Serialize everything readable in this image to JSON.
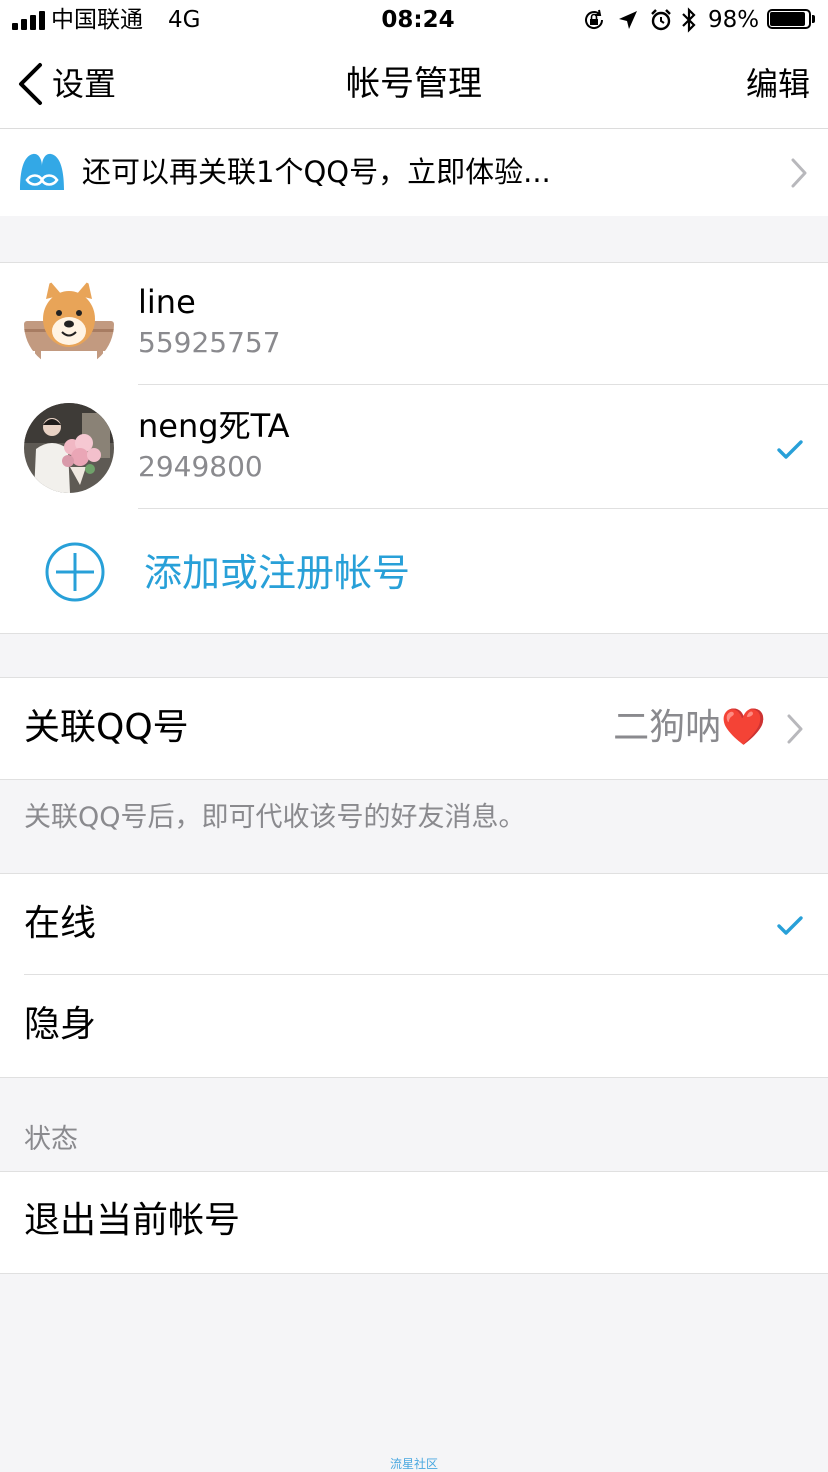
{
  "status_bar": {
    "carrier": "中国联通",
    "network": "4G",
    "time": "08:24",
    "battery": "98%",
    "battery_level": 0.98,
    "icons": [
      "orientation-lock-icon",
      "location-icon",
      "alarm-icon",
      "bluetooth-icon"
    ]
  },
  "nav": {
    "back_label": "设置",
    "title": "帐号管理",
    "edit_label": "编辑"
  },
  "banner": {
    "text": "还可以再关联1个QQ号，立即体验...",
    "icon": "link-accounts-icon"
  },
  "accounts": [
    {
      "name": "line",
      "number": "55925757",
      "selected": false,
      "avatar": "shiba-dog-avatar"
    },
    {
      "name": "neng死TA",
      "number": "2949800",
      "selected": true,
      "avatar": "person-flowers-avatar"
    }
  ],
  "add_account_label": "添加或注册帐号",
  "linked_qq": {
    "label": "关联QQ号",
    "value": "二狗呐❤️",
    "note": "关联QQ号后，即可代收该号的好友消息。"
  },
  "status": {
    "options": [
      {
        "label": "在线",
        "selected": true
      },
      {
        "label": "隐身",
        "selected": false
      }
    ],
    "section_label": "状态"
  },
  "logout_label": "退出当前帐号",
  "watermark": "流星社区",
  "colors": {
    "accent": "#28a0d8",
    "check": "#28a0d8",
    "background": "#f5f5f7"
  }
}
